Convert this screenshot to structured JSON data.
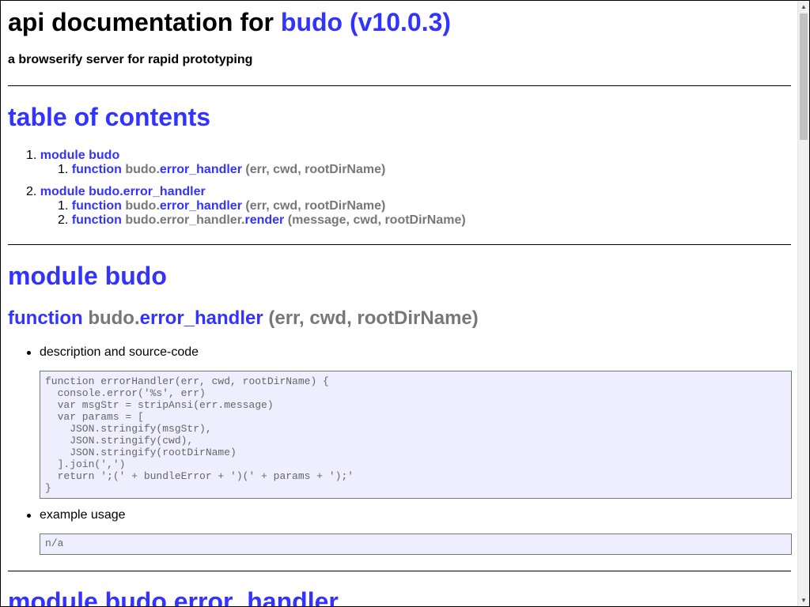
{
  "header": {
    "title_prefix": "api documentation for ",
    "title_link": "budo (v10.0.3)",
    "subtitle": "a browserify server for rapid prototyping"
  },
  "toc": {
    "title": "table of contents",
    "items": [
      {
        "num": "1.",
        "label": "module budo",
        "children": [
          {
            "num": "1.",
            "kw": "function",
            "prefix": "budo.",
            "name": "error_handler",
            "args": "(err, cwd, rootDirName)"
          }
        ]
      },
      {
        "num": "2.",
        "label": "module budo.error_handler",
        "children": [
          {
            "num": "1.",
            "kw": "function",
            "prefix": "budo.",
            "name": "error_handler",
            "args": "(err, cwd, rootDirName)"
          },
          {
            "num": "2.",
            "kw": "function",
            "prefix": "budo.error_handler.",
            "name": "render",
            "args": "(message, cwd, rootDirName)"
          }
        ]
      }
    ]
  },
  "module1": {
    "title": "module budo",
    "fn": {
      "kw": "function",
      "prefix": "budo.",
      "name": "error_handler",
      "args": "(err, cwd, rootDirName)"
    },
    "desc_label": "description and source-code",
    "source": "function errorHandler(err, cwd, rootDirName) {\n  console.error('%s', err)\n  var msgStr = stripAnsi(err.message)\n  var params = [\n    JSON.stringify(msgStr),\n    JSON.stringify(cwd),\n    JSON.stringify(rootDirName)\n  ].join(',')\n  return ';(' + bundleError + ')(' + params + ');'\n}",
    "example_label": "example usage",
    "example": "n/a"
  },
  "module2": {
    "title": "module budo.error_handler"
  },
  "colors": {
    "link": "#3333ff",
    "muted": "#777777",
    "code_bg": "#eeeeff"
  }
}
